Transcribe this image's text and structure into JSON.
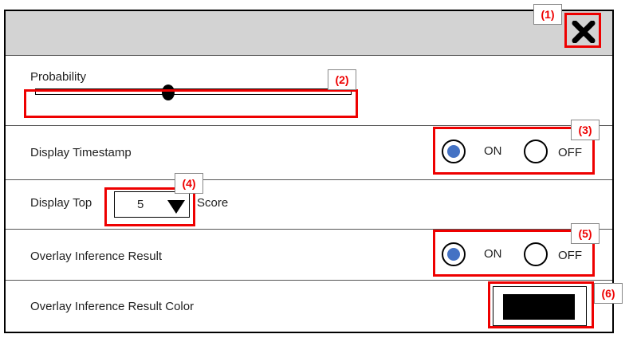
{
  "annotations": {
    "c1": "(1)",
    "c2": "(2)",
    "c3": "(3)",
    "c4": "(4)",
    "c5": "(5)",
    "c6": "(6)",
    "color": "#e00000"
  },
  "close": {
    "icon": "close-icon"
  },
  "probability": {
    "label": "Probability",
    "value_fraction": 0.42
  },
  "timestamp": {
    "label": "Display Timestamp",
    "on_label": "ON",
    "off_label": "OFF",
    "selected": "ON"
  },
  "top_score": {
    "label_before": "Display Top",
    "value": "5",
    "label_after": "Score"
  },
  "overlay": {
    "label": "Overlay Inference Result",
    "on_label": "ON",
    "off_label": "OFF",
    "selected": "ON"
  },
  "overlay_color": {
    "label": "Overlay Inference Result Color",
    "color": "#000000"
  },
  "colors": {
    "radio_selected": "#4472c4",
    "titlebar": "#d3d3d3"
  }
}
